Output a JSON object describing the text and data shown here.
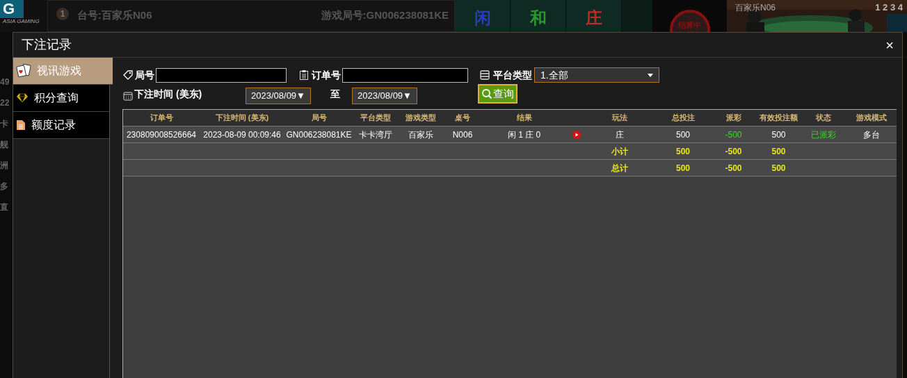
{
  "lobby": {
    "logo_letter": "G",
    "logo_caption": "ASIA GAMING",
    "table_badge": "1",
    "table_name": "台号:百家乐N06",
    "round_id": "游戏局号:GN006238081KE",
    "bet_zones": [
      {
        "label": "闲",
        "color": "#2a3cc0"
      },
      {
        "label": "和",
        "color": "#2a9a2a"
      },
      {
        "label": "庄",
        "color": "#c02a2a"
      }
    ],
    "status_stamp": "结算中",
    "video_label": "百家乐N06",
    "video_tabs": "1 2 3 4",
    "side_fragments": [
      "49",
      "22",
      "卡",
      "舰",
      "洲",
      "多",
      "直"
    ]
  },
  "dialog": {
    "title": "下注记录",
    "close": "×",
    "sidebar": [
      {
        "label": "视讯游戏",
        "selected": true
      },
      {
        "label": "积分查询",
        "selected": false
      },
      {
        "label": "额度记录",
        "selected": false
      }
    ],
    "filters": {
      "round_label": "局号",
      "order_label": "订单号",
      "platform_label": "平台类型",
      "platform_value": "1.全部",
      "time_label": "下注时间 (美东)",
      "date_from": "2023/08/09▼",
      "to_label": "至",
      "date_to": "2023/08/09▼",
      "search_button": "查询"
    },
    "table": {
      "columns": [
        "订单号",
        "下注时间 (美东)",
        "局号",
        "平台类型",
        "游戏类型",
        "桌号",
        "结果",
        "",
        "玩法",
        "总投注",
        "派彩",
        "有效投注额",
        "状态",
        "游戏模式"
      ],
      "rows": [
        {
          "kind": "record",
          "cells": [
            "230809008526664",
            "2023-08-09 00:09:46",
            "GN006238081KE",
            "卡卡湾厅",
            "百家乐",
            "N006",
            "闲 1 庄 0",
            "",
            "庄",
            "500",
            "-500",
            "500",
            "已派彩",
            "多台"
          ]
        },
        {
          "kind": "subtotal",
          "cells": [
            "",
            "",
            "",
            "",
            "",
            "",
            "",
            "",
            "小计",
            "500",
            "-500",
            "500",
            "",
            ""
          ]
        },
        {
          "kind": "total",
          "cells": [
            "",
            "",
            "",
            "",
            "",
            "",
            "",
            "",
            "总计",
            "500",
            "-500",
            "500",
            "",
            ""
          ]
        }
      ]
    }
  }
}
